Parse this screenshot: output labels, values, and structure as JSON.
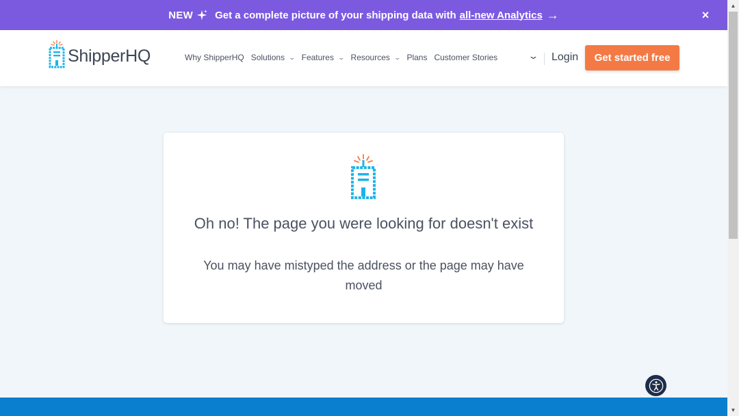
{
  "banner": {
    "new_label": "NEW",
    "message": "Get a complete picture of your shipping data with",
    "link_text": "all-new Analytics",
    "arrow": "→",
    "close": "×",
    "background": "#7b5ae0"
  },
  "header": {
    "logo_text": "ShipperHQ",
    "nav": [
      {
        "label": "Why ShipperHQ",
        "dropdown": false
      },
      {
        "label": "Solutions",
        "dropdown": true
      },
      {
        "label": "Features",
        "dropdown": true
      },
      {
        "label": "Resources",
        "dropdown": true
      },
      {
        "label": "Plans",
        "dropdown": false
      },
      {
        "label": "Customer Stories",
        "dropdown": false
      }
    ],
    "login_label": "Login",
    "cta_label": "Get started free",
    "cta_color": "#f47a45"
  },
  "error_card": {
    "title": "Oh no! The page you were looking for doesn't exist",
    "subtitle": "You may have mistyped the address or the page may have moved"
  },
  "icons": {
    "mascot": "shipperhq-building-icon",
    "accessibility": "accessibility-icon",
    "chevron": "chevron-down-icon"
  },
  "colors": {
    "page_bg": "#f0f6f9",
    "footer_strip": "#0a7fcf",
    "accent_blue": "#1ab4e8"
  }
}
